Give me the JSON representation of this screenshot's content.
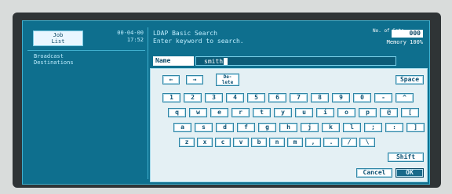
{
  "header": {
    "job_list_line1": "Job",
    "job_list_line2": "List",
    "date": "00-04-00",
    "time": "17:52",
    "title": "LDAP Basic Search",
    "instruction": "Enter keyword to search.",
    "memory_label": "No. of Sets",
    "memory_value": "000",
    "memory_status": "Memory 100%"
  },
  "left_panel": {
    "line1": "Broadcast",
    "line2": "Destinations"
  },
  "name_row": {
    "label": "Name",
    "value": "smith"
  },
  "keyboard": {
    "nav": {
      "left": "←",
      "right": "→",
      "delete_line1": "De-",
      "delete_line2": "lete",
      "space": "Space"
    },
    "row_numbers": [
      "1",
      "2",
      "3",
      "4",
      "5",
      "6",
      "7",
      "8",
      "9",
      "0",
      "-",
      "^"
    ],
    "row_top": [
      "q",
      "w",
      "e",
      "r",
      "t",
      "y",
      "u",
      "i",
      "o",
      "p",
      "@",
      "["
    ],
    "row_mid": [
      "a",
      "s",
      "d",
      "f",
      "g",
      "h",
      "j",
      "k",
      "l",
      ";",
      ":",
      "]"
    ],
    "row_bottom": [
      "z",
      "x",
      "c",
      "v",
      "b",
      "n",
      "m",
      ",",
      ".",
      "/",
      "\\"
    ],
    "shift": "Shift",
    "cancel": "Cancel",
    "ok": "OK"
  },
  "colors": {
    "screen_bg": "#0e6f8e",
    "key_bg": "#ffffff",
    "key_text": "#0d5274",
    "bezel": "#2f3436"
  }
}
